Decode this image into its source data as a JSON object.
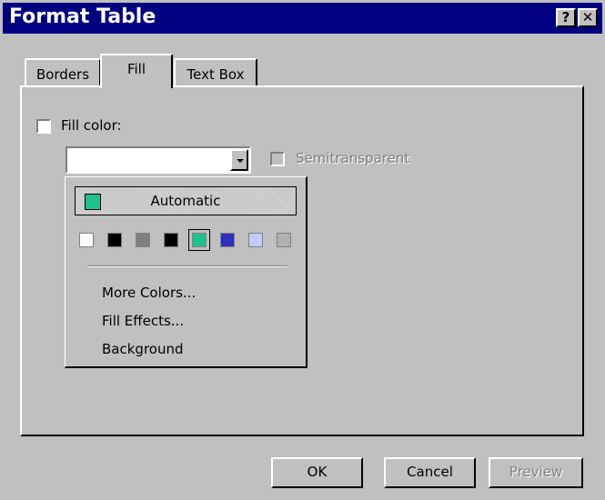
{
  "window": {
    "title": "Format Table",
    "help_label": "?",
    "close_label": "✕"
  },
  "tabs": [
    {
      "label": "Borders",
      "active": false
    },
    {
      "label": "Fill",
      "active": true
    },
    {
      "label": "Text Box",
      "active": false
    }
  ],
  "fill": {
    "fill_color_label": "Fill color:",
    "fill_color_checked": false,
    "combo_value": "",
    "semitransparent_label": "Semitransparent",
    "semitransparent_enabled": false
  },
  "dropdown": {
    "automatic_label": "Automatic",
    "automatic_color": "#20c090",
    "swatches": [
      "#ffffff",
      "#000000",
      "#808080",
      "#000000",
      "#20c090",
      "#3030c0",
      "#c8c8ff",
      "#b0b0b0"
    ],
    "selected_swatch": 4,
    "more_colors": "More Colors...",
    "fill_effects": "Fill Effects...",
    "background": "Background"
  },
  "buttons": {
    "ok": "OK",
    "cancel": "Cancel",
    "preview": "Preview"
  }
}
